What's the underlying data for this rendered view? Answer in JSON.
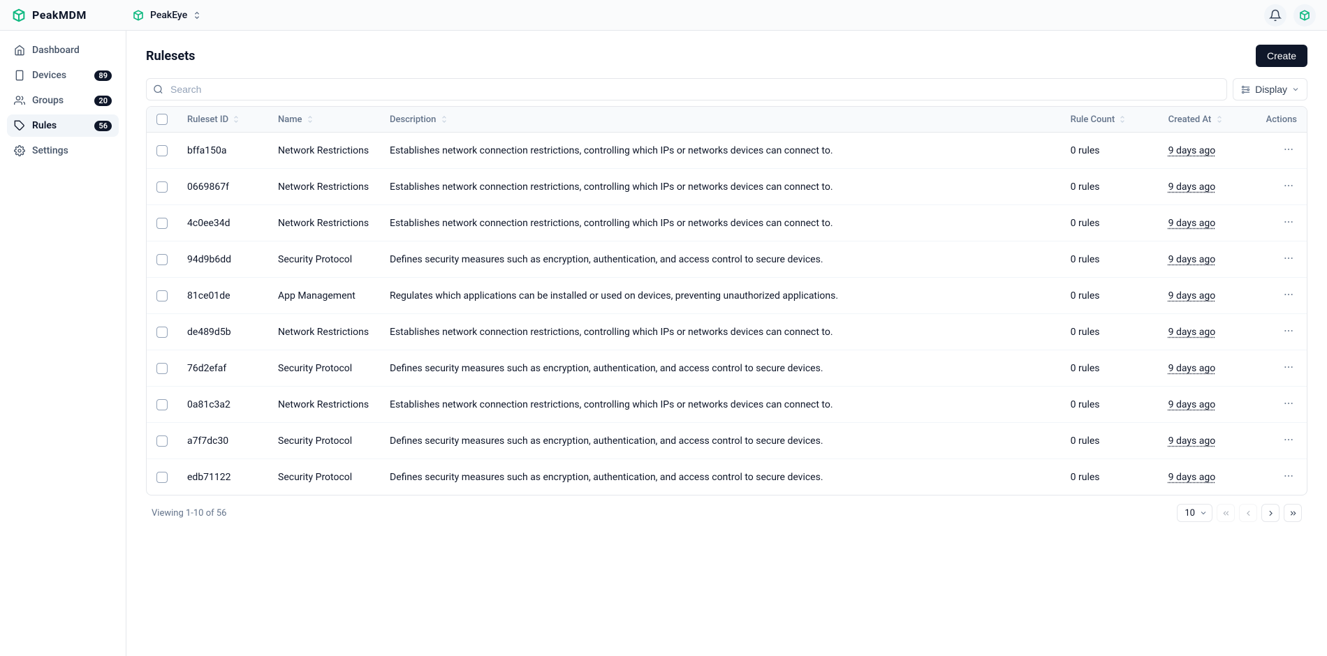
{
  "brand": "PeakMDM",
  "org": "PeakEye",
  "sidebar": {
    "items": [
      {
        "label": "Dashboard",
        "badge": null
      },
      {
        "label": "Devices",
        "badge": "89"
      },
      {
        "label": "Groups",
        "badge": "20"
      },
      {
        "label": "Rules",
        "badge": "56"
      },
      {
        "label": "Settings",
        "badge": null
      }
    ]
  },
  "page": {
    "title": "Rulesets",
    "create_label": "Create",
    "search_placeholder": "Search",
    "display_label": "Display"
  },
  "table": {
    "columns": {
      "id": "Ruleset ID",
      "name": "Name",
      "description": "Description",
      "count": "Rule Count",
      "created": "Created At",
      "actions": "Actions"
    },
    "rows": [
      {
        "id": "bffa150a",
        "name": "Network Restrictions",
        "description": "Establishes network connection restrictions, controlling which IPs or networks devices can connect to.",
        "count": "0 rules",
        "created": "9 days ago"
      },
      {
        "id": "0669867f",
        "name": "Network Restrictions",
        "description": "Establishes network connection restrictions, controlling which IPs or networks devices can connect to.",
        "count": "0 rules",
        "created": "9 days ago"
      },
      {
        "id": "4c0ee34d",
        "name": "Network Restrictions",
        "description": "Establishes network connection restrictions, controlling which IPs or networks devices can connect to.",
        "count": "0 rules",
        "created": "9 days ago"
      },
      {
        "id": "94d9b6dd",
        "name": "Security Protocol",
        "description": "Defines security measures such as encryption, authentication, and access control to secure devices.",
        "count": "0 rules",
        "created": "9 days ago"
      },
      {
        "id": "81ce01de",
        "name": "App Management",
        "description": "Regulates which applications can be installed or used on devices, preventing unauthorized applications.",
        "count": "0 rules",
        "created": "9 days ago"
      },
      {
        "id": "de489d5b",
        "name": "Network Restrictions",
        "description": "Establishes network connection restrictions, controlling which IPs or networks devices can connect to.",
        "count": "0 rules",
        "created": "9 days ago"
      },
      {
        "id": "76d2efaf",
        "name": "Security Protocol",
        "description": "Defines security measures such as encryption, authentication, and access control to secure devices.",
        "count": "0 rules",
        "created": "9 days ago"
      },
      {
        "id": "0a81c3a2",
        "name": "Network Restrictions",
        "description": "Establishes network connection restrictions, controlling which IPs or networks devices can connect to.",
        "count": "0 rules",
        "created": "9 days ago"
      },
      {
        "id": "a7f7dc30",
        "name": "Security Protocol",
        "description": "Defines security measures such as encryption, authentication, and access control to secure devices.",
        "count": "0 rules",
        "created": "9 days ago"
      },
      {
        "id": "edb71122",
        "name": "Security Protocol",
        "description": "Defines security measures such as encryption, authentication, and access control to secure devices.",
        "count": "0 rules",
        "created": "9 days ago"
      }
    ]
  },
  "footer": {
    "viewing": "Viewing 1-10 of 56",
    "page_size": "10"
  }
}
